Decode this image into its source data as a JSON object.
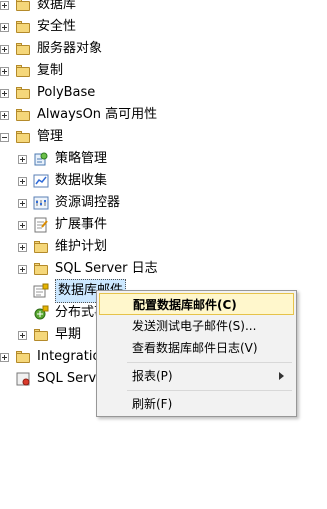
{
  "tree": {
    "items": [
      {
        "label": "数据库"
      },
      {
        "label": "安全性"
      },
      {
        "label": "服务器对象"
      },
      {
        "label": "复制"
      },
      {
        "label": "PolyBase"
      },
      {
        "label": "AlwaysOn 高可用性"
      },
      {
        "label": "管理"
      },
      {
        "label": "策略管理"
      },
      {
        "label": "数据收集"
      },
      {
        "label": "资源调控器"
      },
      {
        "label": "扩展事件"
      },
      {
        "label": "维护计划"
      },
      {
        "label": "SQL Server 日志"
      },
      {
        "label": "数据库邮件"
      },
      {
        "label": "分布式事"
      },
      {
        "label": "早期"
      },
      {
        "label": "Integration"
      },
      {
        "label": "SQL Server"
      }
    ]
  },
  "context_menu": {
    "items": [
      {
        "label": "配置数据库邮件(C)"
      },
      {
        "label": "发送测试电子邮件(S)..."
      },
      {
        "label": "查看数据库邮件日志(V)"
      },
      {
        "label": "报表(P)"
      },
      {
        "label": "刷新(F)"
      }
    ]
  }
}
